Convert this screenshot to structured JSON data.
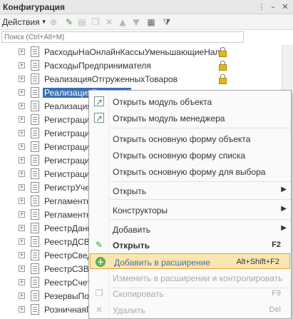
{
  "window": {
    "title": "Конфигурация"
  },
  "toolbar": {
    "actions_label": "Действия"
  },
  "search": {
    "placeholder": "Поиск (Ctrl+Alt+M)"
  },
  "tree": {
    "items": [
      {
        "label": "РасходыНаОнлайнКассыУменьшающиеНал...",
        "locked": true
      },
      {
        "label": "РасходыПредпринимателя",
        "locked": true
      },
      {
        "label": "РеализацияОтгруженныхТоваров",
        "locked": true
      },
      {
        "label": "РеализацияТоваровУ",
        "locked": false,
        "selected": true
      },
      {
        "label": "Реализация",
        "locked": false
      },
      {
        "label": "Регистрация",
        "locked": false
      },
      {
        "label": "Регистрация",
        "locked": false
      },
      {
        "label": "Регистрация",
        "locked": false
      },
      {
        "label": "Регистрация",
        "locked": false
      },
      {
        "label": "Регистрация",
        "locked": false
      },
      {
        "label": "РегистрУче",
        "locked": false
      },
      {
        "label": "Регламентн",
        "locked": false
      },
      {
        "label": "Регламентн",
        "locked": false
      },
      {
        "label": "РеестрДанн",
        "locked": false
      },
      {
        "label": "РеестрДСВ",
        "locked": false
      },
      {
        "label": "РеестрСвед",
        "locked": false
      },
      {
        "label": "РеестрСЗВ",
        "locked": false
      },
      {
        "label": "РеестрСчето",
        "locked": false
      },
      {
        "label": "РезервыПоС",
        "locked": false
      },
      {
        "label": "РозничнаяП",
        "locked": false
      }
    ]
  },
  "context_menu": {
    "open_module_object": "Открыть модуль объекта",
    "open_module_manager": "Открыть модуль менеджера",
    "open_form_object": "Открыть основную форму объекта",
    "open_form_list": "Открыть основную форму списка",
    "open_form_select": "Открыть основную форму для выбора",
    "open_sub": "Открыть",
    "constructors": "Конструкторы",
    "add": "Добавить",
    "open_bold": "Открыть",
    "open_bold_shortcut": "F2",
    "add_to_extension": "Добавить в расширение",
    "add_to_extension_shortcut": "Alt+Shift+F2",
    "change_in_extension": "Изменить в расширении и контролировать",
    "copy": "Скопировать",
    "copy_shortcut": "F9",
    "delete": "Удалить",
    "delete_shortcut": "Del"
  },
  "colors": {
    "selection": "#3b6fb6",
    "highlight_bg": "#fbe6b2",
    "highlight_border": "#e6a23b"
  }
}
